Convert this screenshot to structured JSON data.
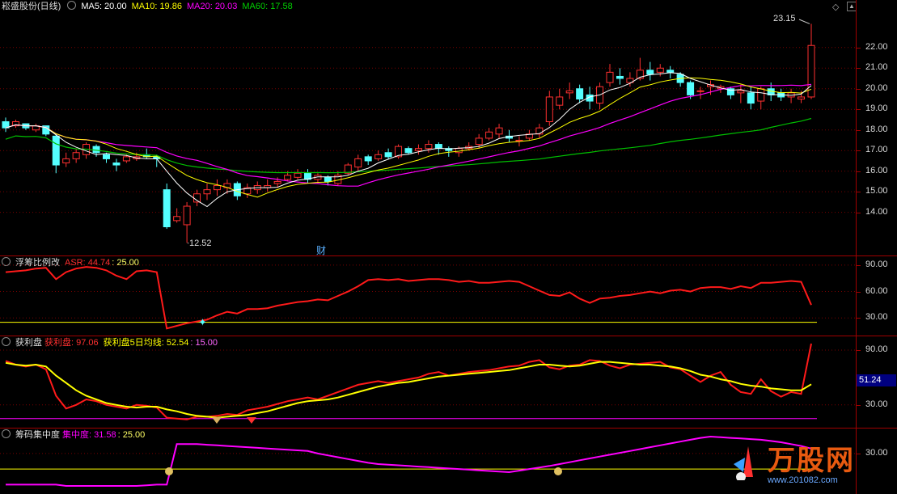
{
  "main": {
    "title": "崧盛股份(日线)",
    "ma5": "MA5: 20.00",
    "ma10": "MA10: 19.86",
    "ma20": "MA20: 20.03",
    "ma60": "MA60: 17.58",
    "high_label": "23.15",
    "low_label": "12.52",
    "fin_marker": "财",
    "ticks": [
      "22.00",
      "21.00",
      "20.00",
      "19.00",
      "18.00",
      "17.00",
      "16.00",
      "15.00",
      "14.00"
    ]
  },
  "panel1": {
    "title": "浮筹比例改",
    "asr": "ASR: 44.74",
    "ref": ": 25.00",
    "ticks": [
      "90.00",
      "60.00",
      "30.00"
    ]
  },
  "panel2": {
    "title": "获利盘",
    "profit": "获利盘: 97.06",
    "avg5": "获利盘5日均线: 52.54",
    "ref": ": 15.00",
    "ticks": [
      "90.00",
      "30.00"
    ],
    "highlight": "51.24"
  },
  "panel3": {
    "title": "筹码集中度",
    "conc": "集中度: 31.58",
    "ref": ": 25.00",
    "ticks": [
      "30.00"
    ]
  },
  "watermark": {
    "brand": "万股网",
    "url": "www.201082.com"
  },
  "colors": {
    "up": "#ff3030",
    "down": "#54ffff",
    "ma5": "#ffffff",
    "ma10": "#ffff00",
    "ma20": "#ff00ff",
    "ma60": "#00c000"
  },
  "chart_data": [
    {
      "type": "candlestick",
      "title": "崧盛股份(日线)",
      "ylim": [
        12.3,
        23.6
      ],
      "candles": [
        [
          18.4,
          18.1,
          18.6,
          17.9
        ],
        [
          18.2,
          18.4,
          18.5,
          18.1
        ],
        [
          18.3,
          18.1,
          18.3,
          18.0
        ],
        [
          18.0,
          18.2,
          18.3,
          17.9
        ],
        [
          18.2,
          17.8,
          18.2,
          17.7
        ],
        [
          17.7,
          16.3,
          17.8,
          15.9
        ],
        [
          16.4,
          16.6,
          16.9,
          16.2
        ],
        [
          16.6,
          16.9,
          17.1,
          16.4
        ],
        [
          16.8,
          17.3,
          17.4,
          16.6
        ],
        [
          17.2,
          16.9,
          17.3,
          16.7
        ],
        [
          16.8,
          16.6,
          16.9,
          16.4
        ],
        [
          16.4,
          16.3,
          16.6,
          16.0
        ],
        [
          16.5,
          16.7,
          16.8,
          16.4
        ],
        [
          16.6,
          16.7,
          16.9,
          16.5
        ],
        [
          16.8,
          16.7,
          17.1,
          16.6
        ],
        [
          16.7,
          16.6,
          16.8,
          16.2
        ],
        [
          15.1,
          13.3,
          15.4,
          13.2
        ],
        [
          13.6,
          13.8,
          14.2,
          13.5
        ],
        [
          13.4,
          14.3,
          14.5,
          12.52
        ],
        [
          14.5,
          14.9,
          15.1,
          14.3
        ],
        [
          14.9,
          15.1,
          15.4,
          14.6
        ],
        [
          15.1,
          15.3,
          15.6,
          14.8
        ],
        [
          15.2,
          15.4,
          15.6,
          14.9
        ],
        [
          15.4,
          14.8,
          15.5,
          14.6
        ],
        [
          14.9,
          15.2,
          15.4,
          14.7
        ],
        [
          15.1,
          15.3,
          15.5,
          14.9
        ],
        [
          15.2,
          15.3,
          15.6,
          15.0
        ],
        [
          15.4,
          15.5,
          15.7,
          15.2
        ],
        [
          15.6,
          15.8,
          16.0,
          15.5
        ],
        [
          15.7,
          15.9,
          16.1,
          15.6
        ],
        [
          15.9,
          15.6,
          16.1,
          15.4
        ],
        [
          15.6,
          15.8,
          15.9,
          15.4
        ],
        [
          15.7,
          15.5,
          15.8,
          15.3
        ],
        [
          15.4,
          15.8,
          16.0,
          15.3
        ],
        [
          15.9,
          16.3,
          16.4,
          15.8
        ],
        [
          16.2,
          16.6,
          16.8,
          16.0
        ],
        [
          16.7,
          16.5,
          16.8,
          16.3
        ],
        [
          16.6,
          16.8,
          17.0,
          16.5
        ],
        [
          16.9,
          16.7,
          17.1,
          16.6
        ],
        [
          16.7,
          17.2,
          17.3,
          16.6
        ],
        [
          17.1,
          16.9,
          17.2,
          16.8
        ],
        [
          17.0,
          17.1,
          17.3,
          16.8
        ],
        [
          17.1,
          17.3,
          17.5,
          16.9
        ],
        [
          17.3,
          17.1,
          17.4,
          16.8
        ],
        [
          17.1,
          17.0,
          17.2,
          16.7
        ],
        [
          16.9,
          17.1,
          17.2,
          16.7
        ],
        [
          17.1,
          17.2,
          17.4,
          17.0
        ],
        [
          17.3,
          17.6,
          17.8,
          17.1
        ],
        [
          17.6,
          17.9,
          18.1,
          17.5
        ],
        [
          17.8,
          18.1,
          18.3,
          17.6
        ],
        [
          17.7,
          17.6,
          18.0,
          17.4
        ],
        [
          17.5,
          17.5,
          17.7,
          17.2
        ],
        [
          17.6,
          17.8,
          18.0,
          17.5
        ],
        [
          17.8,
          18.1,
          18.3,
          17.6
        ],
        [
          18.4,
          19.6,
          19.9,
          18.2
        ],
        [
          19.2,
          19.6,
          20.0,
          19.0
        ],
        [
          19.8,
          19.9,
          20.3,
          19.5
        ],
        [
          20.0,
          19.5,
          20.2,
          19.3
        ],
        [
          19.7,
          19.4,
          20.1,
          19.0
        ],
        [
          19.3,
          20.1,
          20.3,
          19.0
        ],
        [
          20.3,
          20.8,
          21.2,
          20.1
        ],
        [
          20.6,
          20.5,
          21.0,
          20.2
        ],
        [
          20.3,
          20.5,
          20.8,
          20.1
        ],
        [
          20.5,
          20.9,
          21.5,
          20.4
        ],
        [
          20.9,
          20.7,
          21.3,
          20.4
        ],
        [
          20.8,
          21.0,
          21.2,
          20.6
        ],
        [
          20.9,
          20.8,
          21.1,
          20.5
        ],
        [
          20.7,
          20.3,
          20.8,
          20.1
        ],
        [
          20.3,
          19.7,
          20.4,
          19.5
        ],
        [
          19.9,
          19.9,
          20.1,
          19.5
        ],
        [
          20.1,
          20.2,
          20.4,
          19.7
        ],
        [
          20.0,
          20.1,
          20.2,
          19.8
        ],
        [
          20.0,
          19.7,
          20.1,
          19.5
        ],
        [
          19.8,
          19.9,
          20.2,
          19.3
        ],
        [
          19.8,
          19.3,
          20.1,
          19.0
        ],
        [
          19.4,
          20.0,
          20.1,
          19.0
        ],
        [
          20.0,
          19.7,
          20.3,
          19.4
        ],
        [
          19.8,
          19.6,
          20.0,
          19.4
        ],
        [
          19.6,
          19.8,
          20.0,
          19.3
        ],
        [
          19.5,
          19.6,
          19.9,
          19.3
        ],
        [
          19.6,
          22.1,
          23.15,
          19.5
        ]
      ]
    },
    {
      "type": "line",
      "title": "浮筹比例改",
      "ylim": [
        10,
        100
      ],
      "series": [
        {
          "name": "ASR",
          "values": [
            82,
            83,
            84,
            86,
            87,
            74,
            82,
            86,
            88,
            87,
            84,
            78,
            74,
            83,
            84,
            82,
            18,
            21,
            24,
            26,
            28,
            33,
            37,
            35,
            40,
            40,
            41,
            44,
            46,
            48,
            49,
            51,
            50,
            55,
            60,
            66,
            73,
            74,
            73,
            74,
            72,
            73,
            74,
            74,
            73,
            71,
            72,
            70,
            70,
            71,
            72,
            71,
            66,
            61,
            56,
            55,
            59,
            52,
            47,
            52,
            53,
            55,
            56,
            58,
            60,
            58,
            61,
            62,
            60,
            64,
            65,
            65,
            63,
            66,
            64,
            70,
            70,
            71,
            72,
            71,
            44.74
          ]
        },
        {
          "name": "",
          "values": [
            25
          ]
        }
      ]
    },
    {
      "type": "line",
      "title": "获利盘",
      "ylim": [
        5,
        105
      ],
      "series": [
        {
          "name": "获利盘",
          "values": [
            78,
            74,
            72,
            74,
            69,
            40,
            26,
            30,
            36,
            34,
            30,
            28,
            26,
            30,
            29,
            27,
            16,
            15,
            14,
            17,
            17,
            18,
            20,
            19,
            24,
            26,
            28,
            31,
            34,
            36,
            38,
            36,
            40,
            44,
            48,
            52,
            54,
            56,
            54,
            56,
            58,
            60,
            64,
            66,
            62,
            64,
            66,
            67,
            68,
            70,
            72,
            73,
            77,
            79,
            71,
            69,
            73,
            74,
            79,
            78,
            73,
            70,
            74,
            75,
            76,
            77,
            71,
            69,
            62,
            55,
            62,
            66,
            52,
            44,
            42,
            58,
            45,
            39,
            44,
            42,
            97.06
          ]
        },
        {
          "name": "获利盘5日均线",
          "values": [
            76,
            74,
            73,
            74,
            72,
            62,
            54,
            46,
            40,
            36,
            32,
            30,
            28,
            27,
            28,
            28,
            25,
            23,
            20,
            18,
            17,
            16,
            17,
            18,
            19,
            21,
            23,
            26,
            29,
            32,
            34,
            35,
            36,
            38,
            41,
            44,
            47,
            50,
            52,
            54,
            55,
            57,
            59,
            61,
            62,
            63,
            64,
            65,
            66,
            67,
            68,
            70,
            72,
            74,
            74,
            73,
            72,
            73,
            75,
            77,
            77,
            76,
            75,
            74,
            74,
            73,
            72,
            70,
            67,
            63,
            61,
            58,
            56,
            53,
            51,
            50,
            48,
            47,
            46,
            46,
            52.54
          ]
        },
        {
          "name": "",
          "values": [
            15
          ]
        }
      ]
    },
    {
      "type": "line",
      "title": "筹码集中度",
      "ylim": [
        17,
        38
      ],
      "series": [
        {
          "name": "集中度",
          "values": [
            20,
            20,
            20,
            20,
            20,
            20,
            19.6,
            19.6,
            19.6,
            19.6,
            19.6,
            19.6,
            19.6,
            19.6,
            19.8,
            20,
            20,
            33,
            33,
            33,
            32.8,
            32.6,
            32.4,
            32.2,
            32,
            31.8,
            31.6,
            31.4,
            31.2,
            31,
            30.8,
            30,
            29.4,
            28.8,
            28.2,
            27.6,
            27,
            26.6,
            26.4,
            26.2,
            26,
            25.8,
            25.6,
            25.4,
            25.2,
            25,
            24.8,
            24.6,
            24.4,
            24.2,
            24,
            24.5,
            25,
            25.5,
            26,
            26.6,
            27.2,
            27.8,
            28.4,
            29,
            29.6,
            30.2,
            30.8,
            31.4,
            32,
            32.6,
            33.2,
            33.8,
            34.4,
            35,
            35.4,
            35.2,
            35,
            34.8,
            34.6,
            34.4,
            34,
            33.6,
            33,
            32.4,
            31.58
          ]
        },
        {
          "name": "",
          "values": [
            25
          ]
        }
      ]
    }
  ]
}
